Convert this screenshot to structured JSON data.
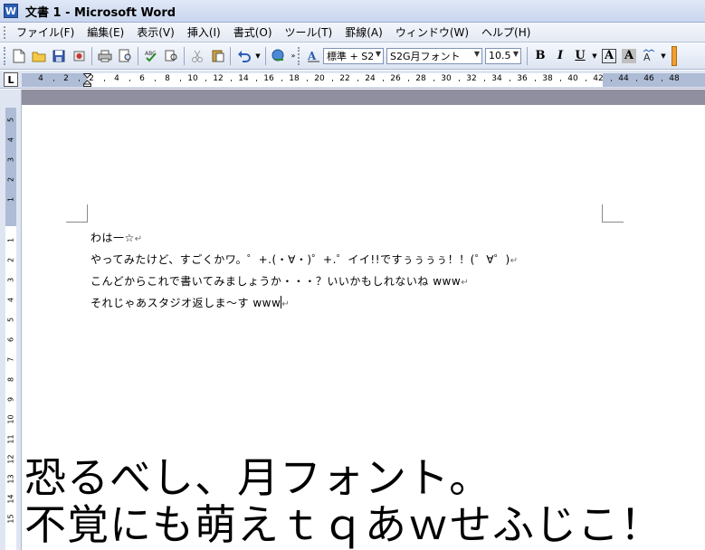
{
  "window": {
    "app_icon_letter": "W",
    "title": "文書 1 - Microsoft Word"
  },
  "menu": {
    "items": [
      {
        "label": "ファイル(F)"
      },
      {
        "label": "編集(E)"
      },
      {
        "label": "表示(V)"
      },
      {
        "label": "挿入(I)"
      },
      {
        "label": "書式(O)"
      },
      {
        "label": "ツール(T)"
      },
      {
        "label": "罫線(A)"
      },
      {
        "label": "ウィンドウ(W)"
      },
      {
        "label": "ヘルプ(H)"
      }
    ]
  },
  "toolbar": {
    "style_value": "標準 + S2",
    "font_value": "S2G月フォント",
    "size_value": "10.5",
    "bold_label": "B",
    "italic_label": "I",
    "underline_label": "U",
    "highlight_label": "A",
    "fontcolor_label": "A",
    "icons": [
      "new-document-icon",
      "open-folder-icon",
      "save-icon",
      "permission-icon",
      "print-icon",
      "print-preview-icon",
      "spelling-icon",
      "research-icon",
      "cut-icon",
      "paste-icon",
      "undo-icon",
      "hyperlink-icon",
      "styles-formatting-icon"
    ]
  },
  "ruler": {
    "tab_selector": "L",
    "h_ticks": [
      "4",
      "2",
      "2",
      "4",
      "6",
      "8",
      "10",
      "12",
      "14",
      "16",
      "18",
      "20",
      "22",
      "24",
      "26",
      "28",
      "30",
      "32",
      "34",
      "36",
      "38",
      "40",
      "42",
      "44",
      "46",
      "48"
    ],
    "v_ticks": [
      "5",
      "4",
      "3",
      "2",
      "1",
      "1",
      "2",
      "3",
      "4",
      "5",
      "6",
      "7",
      "8",
      "9",
      "10",
      "11",
      "12",
      "13",
      "14",
      "15"
    ]
  },
  "document": {
    "lines": [
      "わは一☆",
      "やってみたけど、すごくかワ。゜+.(・∀・)゜+.゜イイ!!ですぅぅぅぅ！！(゜∀゜)",
      "こんどからこれで書いてみましょうか・・・？いいかもしれないね www",
      "それじゃあスタジオ返しま～す www"
    ],
    "paragraph_mark": "↵"
  },
  "caption": {
    "line1": "恐るべし、月フォント。",
    "line2": "不覚にも萌えｔｑあｗせふじこ！"
  }
}
